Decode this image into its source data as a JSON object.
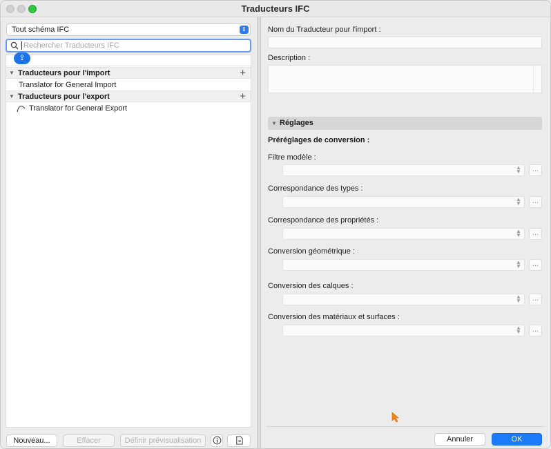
{
  "window": {
    "title": "Traducteurs IFC"
  },
  "left": {
    "schema_select": "Tout schéma IFC",
    "search_placeholder": "Rechercher Traducteurs IFC",
    "groups": [
      {
        "label": "Traducteurs pour l'import",
        "items": [
          "Translator for General Import"
        ]
      },
      {
        "label": "Traducteurs pour l'export",
        "items": [
          "Translator for General Export"
        ]
      }
    ],
    "buttons": {
      "new": "Nouveau...",
      "delete": "Effacer",
      "preview": "Définir prévisualisation"
    }
  },
  "right": {
    "name_label": "Nom du Traducteur pour l'import :",
    "name_value": "",
    "description_label": "Description :",
    "settings_section": "Réglages",
    "presets_label": "Préréglages de conversion :",
    "rows": [
      {
        "label": "Filtre modèle :",
        "value": ""
      },
      {
        "label": "Correspondance des types :",
        "value": ""
      },
      {
        "label": "Correspondance des propriétés :",
        "value": ""
      },
      {
        "label": "Conversion géométrique :",
        "value": ""
      },
      {
        "label": "Conversion des calques :",
        "value": ""
      },
      {
        "label": "Conversion des matériaux et surfaces :",
        "value": ""
      }
    ],
    "more_button": "...",
    "cancel": "Annuler",
    "ok": "OK"
  },
  "colors": {
    "accent": "#1a7af8",
    "close_light": "#d0d0d0",
    "zoom_light": "#2fc840"
  },
  "icons": [
    "search-icon",
    "shift-badge-icon",
    "disclosure-triangle-icon",
    "plus-icon",
    "curve-icon",
    "info-icon",
    "export-file-icon",
    "stepper-icon"
  ]
}
